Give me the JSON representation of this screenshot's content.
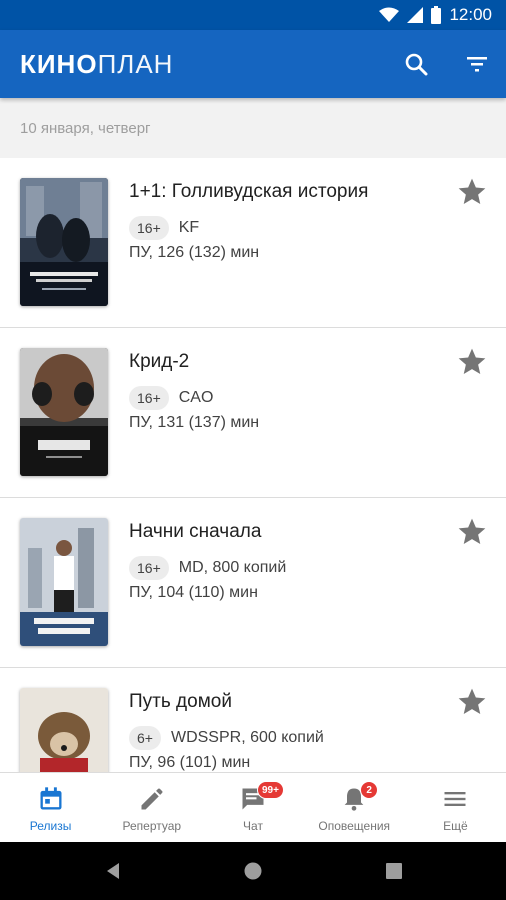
{
  "status_bar": {
    "time": "12:00"
  },
  "app_bar": {
    "logo_bold": "КИНО",
    "logo_light": "ПЛАН",
    "actions": [
      "search-icon",
      "filter-icon"
    ]
  },
  "date_header": "10 января, четверг",
  "releases": [
    {
      "title": "1+1: Голливудская история",
      "age": "16+",
      "distributor": "KF",
      "duration": "ПУ, 126 (132) мин",
      "poster_text": "1+1 ГОЛЛИВУДСКАЯ ИСТОРИЯ"
    },
    {
      "title": "Крид-2",
      "age": "16+",
      "distributor": "CAO",
      "duration": "ПУ, 131 (137) мин",
      "poster_text": "КРИД 2"
    },
    {
      "title": "Начни сначала",
      "age": "16+",
      "distributor": "MD, 800 копий",
      "duration": "ПУ, 104 (110) мин",
      "poster_text": "НАЧНИ СНАЧАЛА"
    },
    {
      "title": "Путь домой",
      "age": "6+",
      "distributor": "WDSSPR, 600 копий",
      "duration": "ПУ, 96 (101) мин",
      "poster_text": ""
    }
  ],
  "bottom_nav": [
    {
      "label": "Релизы",
      "icon": "calendar-icon",
      "active": true
    },
    {
      "label": "Репертуар",
      "icon": "pencil-icon",
      "active": false
    },
    {
      "label": "Чат",
      "icon": "chat-icon",
      "active": false,
      "badge": "99+"
    },
    {
      "label": "Оповещения",
      "icon": "bell-icon",
      "active": false,
      "badge": "2"
    },
    {
      "label": "Ещё",
      "icon": "menu-icon",
      "active": false
    }
  ],
  "colors": {
    "primary": "#1565c0",
    "status_bar": "#0053a6",
    "accent": "#1976d2",
    "badge": "#e53935",
    "star": "#757575"
  }
}
